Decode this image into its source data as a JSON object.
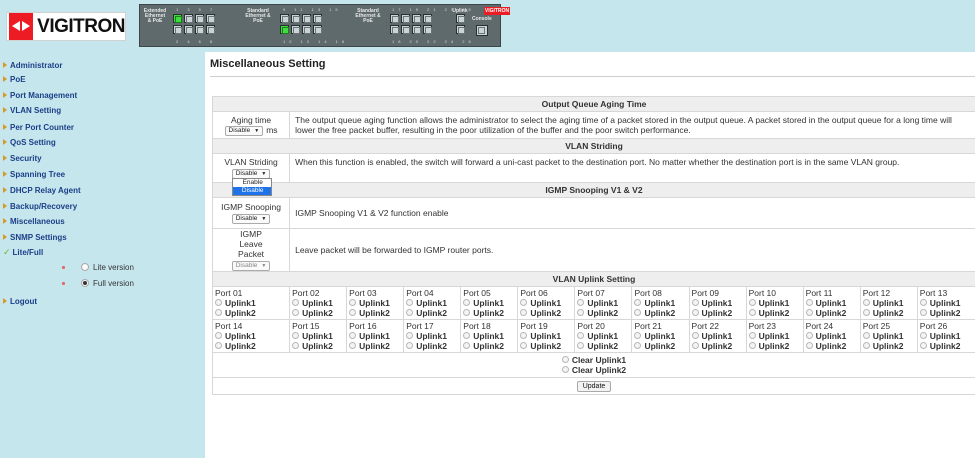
{
  "header": {
    "logo_text": "VIGITRON",
    "device": {
      "labels": [
        "Extended Ethernet & PoE",
        "Standard Ethernet & PoE",
        "Standard Ethernet & PoE"
      ],
      "top_numbers": [
        "1  3  5  7",
        "9  11  13  15",
        "17  19  21  23  25"
      ],
      "bottom_numbers": [
        "2  4  6  8",
        "10  12  14  16",
        "18  20  22  24  26"
      ],
      "uplink_label": "Uplink",
      "console_label": "Console",
      "brand": "VIGITRON"
    }
  },
  "sidebar": {
    "items": [
      {
        "label": "Administrator"
      },
      {
        "label": "PoE"
      },
      {
        "label": "Port Management"
      },
      {
        "label": "VLAN Setting"
      },
      {
        "label": "Per Port Counter"
      },
      {
        "label": "QoS Setting"
      },
      {
        "label": "Security"
      },
      {
        "label": "Spanning Tree"
      },
      {
        "label": "DHCP Relay Agent"
      },
      {
        "label": "Backup/Recovery"
      },
      {
        "label": "Miscellaneous"
      },
      {
        "label": "SNMP Settings"
      },
      {
        "label": "Lite/Full"
      }
    ],
    "sub_items": [
      {
        "label": "Lite version",
        "selected": false
      },
      {
        "label": "Full version",
        "selected": true
      }
    ],
    "logout": "Logout"
  },
  "main": {
    "title": "Miscellaneous Setting",
    "aging": {
      "header": "Output Queue Aging Time",
      "label": "Aging time",
      "value": "Disable",
      "unit": "ms",
      "description": "The output queue aging function allows the administrator to select the aging time of a packet stored in the output queue. A packet stored in the output queue for a long time will lower the free packet buffer, resulting in the poor utilization of the buffer and the poor switch performance."
    },
    "vlan_striding": {
      "header": "VLAN Striding",
      "label": "VLAN Striding",
      "value": "Disable",
      "options": [
        "Enable",
        "Disable"
      ],
      "highlighted": "Disable",
      "description": "When this function is enabled, the switch will forward a uni-cast packet to the destination port. No matter whether the destination port is in the same VLAN group."
    },
    "igmp": {
      "header": "IGMP Snooping V1 & V2",
      "snooping_label": "IGMP Snooping",
      "snooping_value": "Disable",
      "snooping_desc": "IGMP Snooping V1 & V2 function enable",
      "leave_label": "IGMP Leave Packet",
      "leave_value": "Disable",
      "leave_desc": "Leave packet will be forwarded to IGMP router ports."
    },
    "uplink": {
      "header": "VLAN Uplink Setting",
      "option1": "Uplink1",
      "option2": "Uplink2",
      "ports_row1": [
        "Port 01",
        "Port 02",
        "Port 03",
        "Port 04",
        "Port 05",
        "Port 06",
        "Port 07",
        "Port 08",
        "Port 09",
        "Port 10",
        "Port 11",
        "Port 12",
        "Port 13"
      ],
      "ports_row2": [
        "Port 14",
        "Port 15",
        "Port 16",
        "Port 17",
        "Port 18",
        "Port 19",
        "Port 20",
        "Port 21",
        "Port 22",
        "Port 23",
        "Port 24",
        "Port 25",
        "Port 26"
      ],
      "clear1": "Clear Uplink1",
      "clear2": "Clear Uplink2",
      "update": "Update"
    }
  }
}
